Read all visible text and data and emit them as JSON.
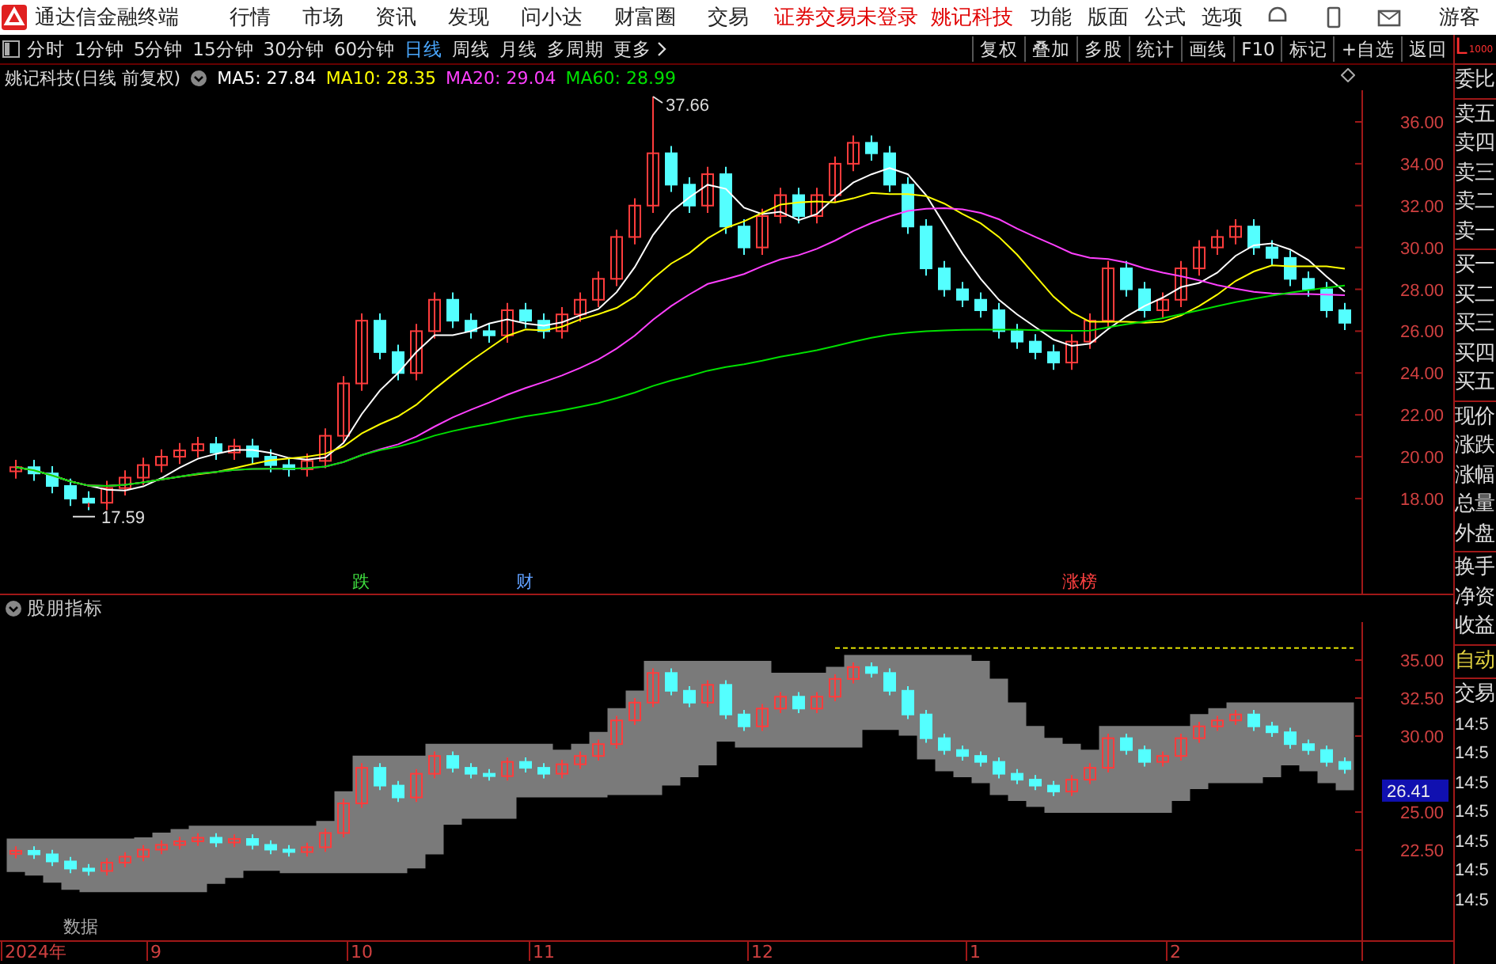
{
  "title_bar": {
    "app_name": "通达信金融终端",
    "menus": [
      "行情",
      "市场",
      "资讯",
      "发现",
      "问小达",
      "财富圈",
      "交易"
    ],
    "login_status": "证券交易未登录",
    "stock_name": "姚记科技",
    "tools": [
      "功能",
      "版面",
      "公式",
      "选项"
    ],
    "user": "游客"
  },
  "toolbar": {
    "periods": [
      {
        "label": "分时",
        "selected": false
      },
      {
        "label": "1分钟",
        "selected": false
      },
      {
        "label": "5分钟",
        "selected": false
      },
      {
        "label": "15分钟",
        "selected": false
      },
      {
        "label": "30分钟",
        "selected": false
      },
      {
        "label": "60分钟",
        "selected": false
      },
      {
        "label": "日线",
        "selected": true
      },
      {
        "label": "周线",
        "selected": false
      },
      {
        "label": "月线",
        "selected": false
      },
      {
        "label": "多周期",
        "selected": false
      },
      {
        "label": "更多",
        "selected": false
      }
    ],
    "actions": [
      "复权",
      "叠加",
      "多股",
      "统计",
      "画线",
      "F10",
      "标记",
      "+自选",
      "返回"
    ]
  },
  "legend": {
    "title": "姚记科技(日线 前复权)",
    "items": [
      {
        "label": "MA5: 27.84",
        "color": "#ffffff"
      },
      {
        "label": "MA10: 28.35",
        "color": "#ffff00"
      },
      {
        "label": "MA20: 29.04",
        "color": "#ff40ff"
      },
      {
        "label": "MA60: 28.99",
        "color": "#00e000"
      }
    ]
  },
  "price_chart": {
    "y_axis_labels": [
      "36.00",
      "34.00",
      "32.00",
      "30.00",
      "28.00",
      "26.00",
      "24.00",
      "22.00",
      "20.00",
      "18.00"
    ],
    "high_label": "37.66",
    "low_label": "17.59",
    "signals": [
      {
        "label": "跌",
        "color": "#40e040"
      },
      {
        "label": "财",
        "color": "#60a0ff"
      },
      {
        "label": "涨榜",
        "color": "#ff4040"
      }
    ]
  },
  "indicator": {
    "title": "股朋指标",
    "note": "数据",
    "y_axis_labels": [
      "35.00",
      "32.50",
      "30.00",
      "25.00",
      "22.50"
    ],
    "current_price": "26.41",
    "date_labels": [
      "2024年",
      "9",
      "10",
      "11",
      "12",
      "1",
      "2"
    ]
  },
  "quote_panel": {
    "mode": "L",
    "mode_sub": "1000",
    "groups": [
      [
        "委比"
      ],
      [
        "卖五",
        "卖四",
        "卖三",
        "卖二",
        "卖一"
      ],
      [
        "买一",
        "买二",
        "买三",
        "买四",
        "买五"
      ],
      [
        "现价",
        "涨跌",
        "涨幅",
        "总量",
        "外盘"
      ],
      [
        "换手",
        "净资",
        "收益"
      ],
      [
        "自动"
      ],
      [
        "交易",
        "14:5",
        "14:5",
        "14:5",
        "14:5",
        "14:5",
        "14:5",
        "14:5"
      ]
    ]
  }
}
